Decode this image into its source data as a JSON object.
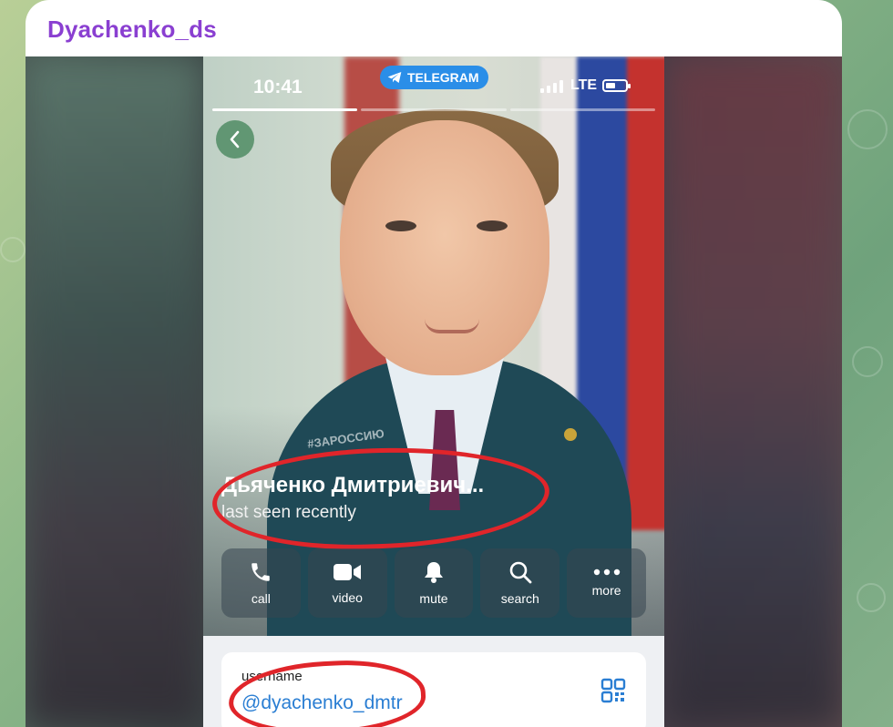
{
  "chat": {
    "title": "Dyachenko_ds"
  },
  "status_bar": {
    "time": "10:41",
    "badge": "TELEGRAM",
    "network": "LTE",
    "battery_level": 0.5
  },
  "profile": {
    "name": "Дьяченко Дмитриевич...",
    "status": "last seen recently",
    "slogan": "#ЗАРОССИЮ"
  },
  "actions": [
    {
      "label": "call",
      "icon": "phone-icon"
    },
    {
      "label": "video",
      "icon": "video-camera-icon"
    },
    {
      "label": "mute",
      "icon": "bell-icon"
    },
    {
      "label": "search",
      "icon": "search-icon"
    },
    {
      "label": "more",
      "icon": "more-dots-icon"
    }
  ],
  "info": {
    "caption": "username",
    "username": "@dyachenko_dmtr"
  },
  "colors": {
    "accent": "#8a3fd1",
    "telegram_blue": "#2a8ee8",
    "link": "#2a7ed3",
    "annotation_red": "#e0252a"
  }
}
